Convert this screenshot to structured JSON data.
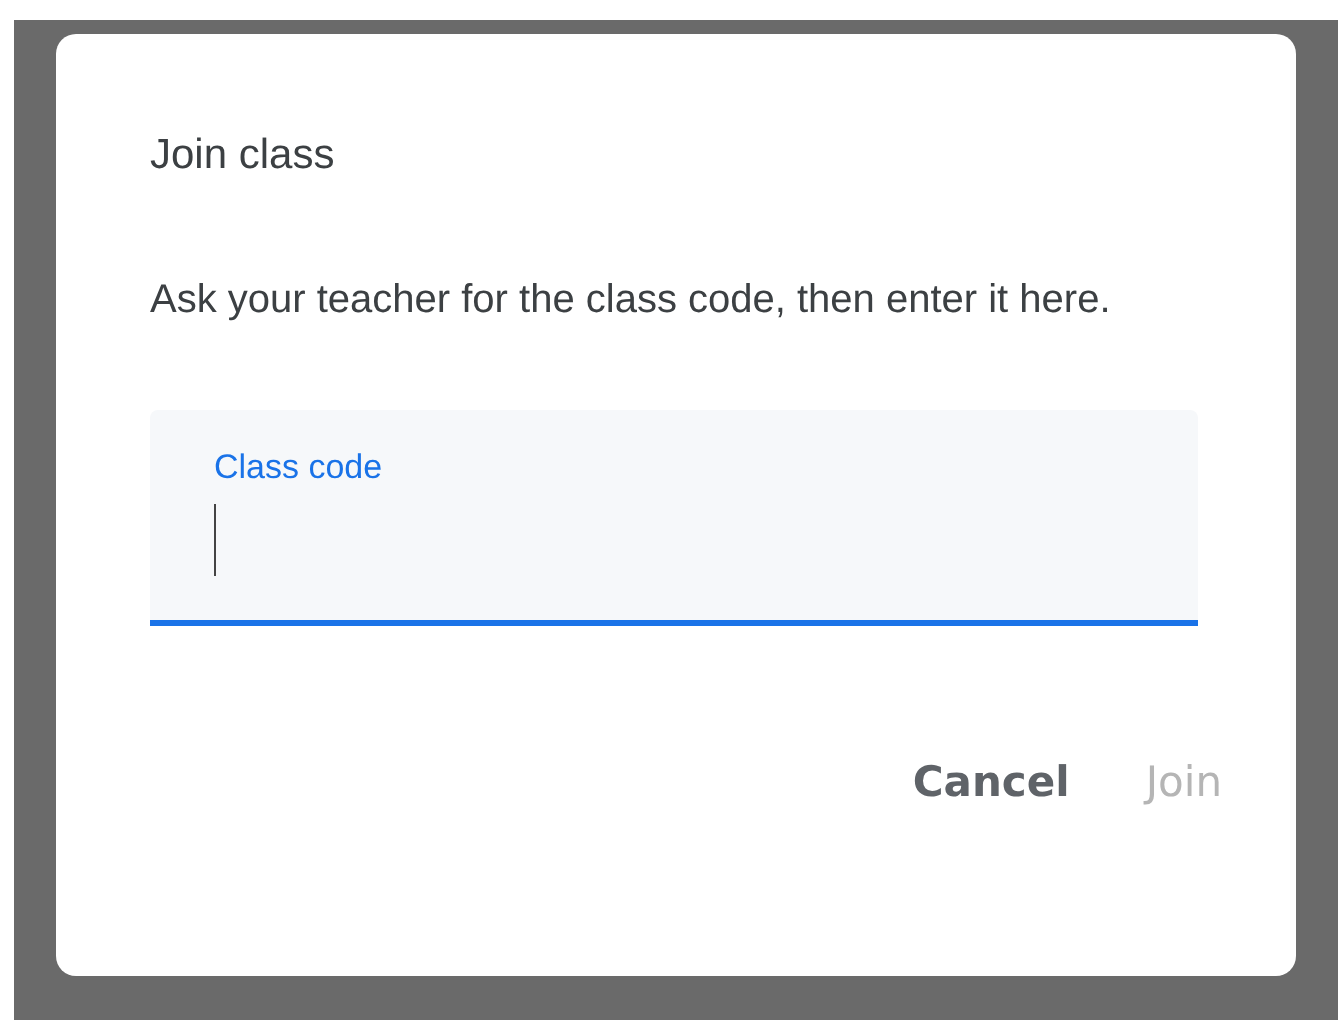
{
  "dialog": {
    "title": "Join class",
    "message": "Ask your teacher for the class code, then enter it here."
  },
  "field": {
    "label": "Class code",
    "focused": true
  },
  "buttons": [
    {
      "label": "Cancel",
      "disabled": false
    },
    {
      "label": "Join",
      "disabled": true
    }
  ]
}
